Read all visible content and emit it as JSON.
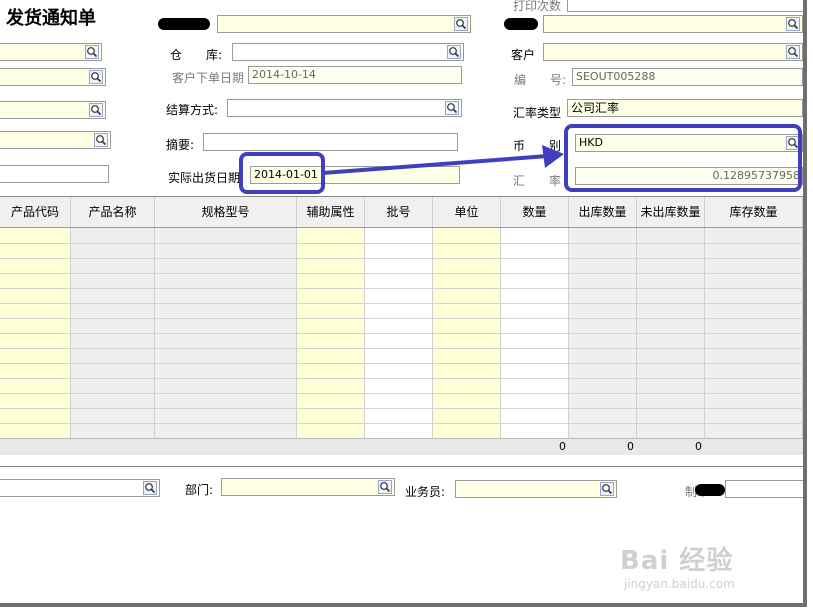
{
  "form": {
    "title": "发货通知单",
    "print_count_label": "打印次数",
    "warehouse_label": "仓　　库:",
    "customer_label": "客户",
    "customer_order_date_label": "客户下单日期",
    "customer_order_date_value": "2014-10-14",
    "number_label": "编　　号:",
    "number_value": "SEOUT005288",
    "settlement_label": "结算方式:",
    "rate_type_label": "汇率类型",
    "rate_type_value": "公司汇率",
    "summary_label": "摘要:",
    "currency_label": "币　　别",
    "currency_value": "HKD",
    "actual_ship_date_label": "实际出货日期",
    "actual_ship_date_value": "2014-01-01",
    "exchange_rate_label": "汇　　率",
    "exchange_rate_value": "0.12895737958"
  },
  "grid": {
    "columns": [
      "产品代码",
      "产品名称",
      "规格型号",
      "辅助属性",
      "批号",
      "单位",
      "数量",
      "出库数量",
      "未出库数量",
      "库存数量"
    ],
    "totals": [
      "0",
      "0",
      "0"
    ]
  },
  "footer": {
    "department_label": "部门:",
    "salesperson_label": "业务员:",
    "maker_label": "制单:"
  },
  "watermark": {
    "brand": "Bai 经验",
    "url": "jingyan.baidu.com"
  },
  "colors": {
    "field_bg": "#ffffe6",
    "highlight": "#3f3fbf",
    "grid_yellow": "#ffffd8"
  },
  "icons": [
    "lookup-icon"
  ]
}
